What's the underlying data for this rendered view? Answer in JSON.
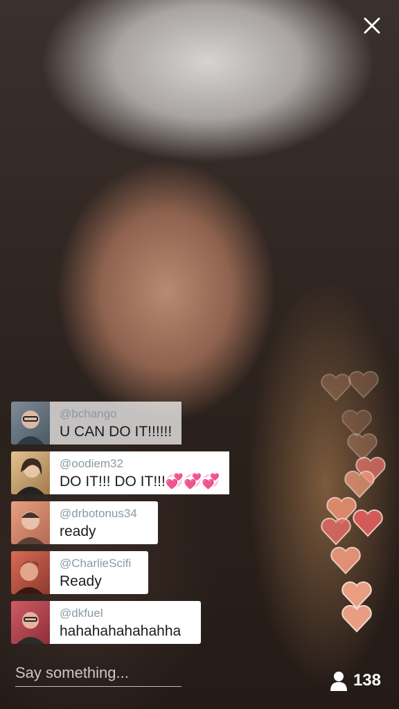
{
  "comments": [
    {
      "user": "@bchango",
      "text": "U CAN DO IT!!!!!!",
      "avatar_color": "#6b7b88"
    },
    {
      "user": "@oodiem32",
      "text": "DO IT!!! DO IT!!!💞💞💞",
      "avatar_color": "#c9a47a"
    },
    {
      "user": "@drbotonus34",
      "text": "ready",
      "avatar_color": "#d08a6c"
    },
    {
      "user": "@CharlieScifi",
      "text": "Ready",
      "avatar_color": "#c85a48"
    },
    {
      "user": "@dkfuel",
      "text": "hahahahahahahha",
      "avatar_color": "#c24a52"
    }
  ],
  "input": {
    "placeholder": "Say something..."
  },
  "viewers": {
    "count": "138"
  },
  "icons": {
    "close": "close-icon",
    "viewers": "person-icon",
    "heart": "heart-icon"
  },
  "colors": {
    "heart_fill": "#f2a488",
    "heart_fill_dark": "#e8746c",
    "bubble_bg": "#ffffff",
    "username": "#8a9aa3"
  }
}
